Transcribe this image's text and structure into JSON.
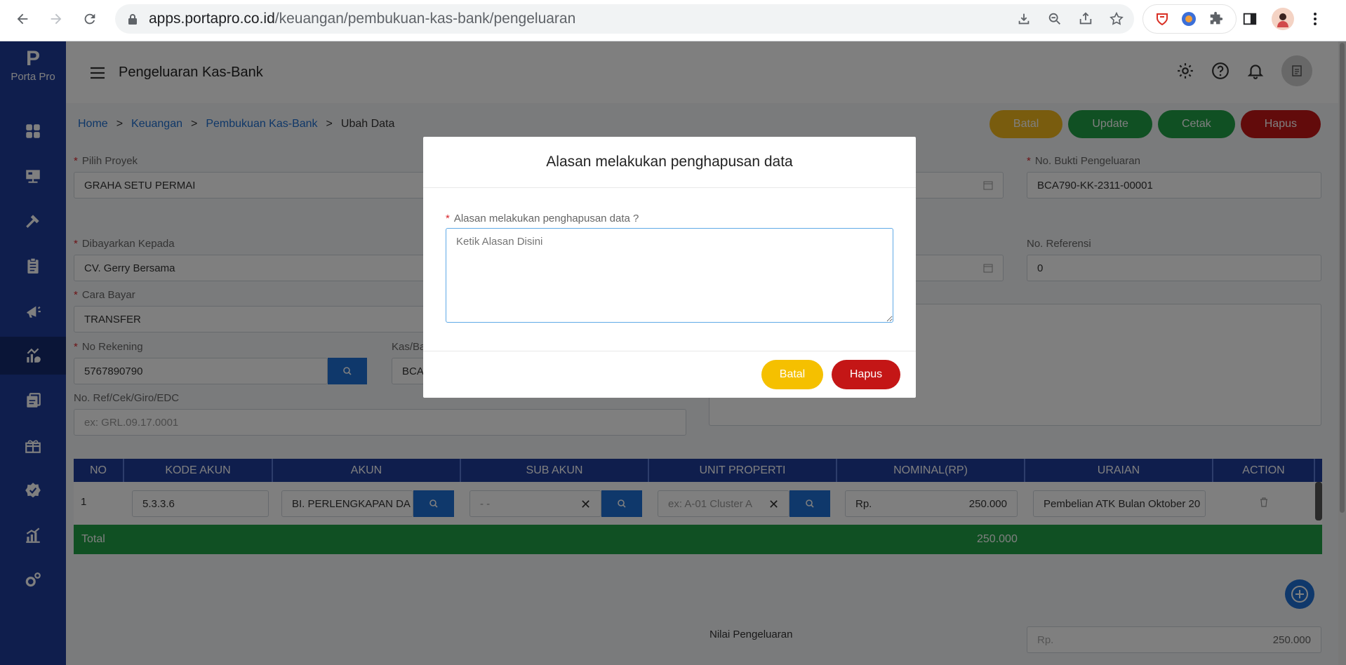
{
  "browser": {
    "url_domain": "apps.portapro.co.id",
    "url_path": "/keuangan/pembukuan-kas-bank/pengeluaran"
  },
  "app": {
    "logo_text": "Porta Pro",
    "logo_mark": "P",
    "page_title": "Pengeluaran Kas-Bank"
  },
  "breadcrumb": {
    "home": "Home",
    "keuangan": "Keuangan",
    "pembukuan": "Pembukuan Kas-Bank",
    "current": "Ubah Data",
    "sep": ">"
  },
  "actions": {
    "batal": "Batal",
    "update": "Update",
    "cetak": "Cetak",
    "hapus": "Hapus"
  },
  "form": {
    "proyek_label": "Pilih Proyek",
    "proyek_value": "GRAHA SETU PERMAI",
    "bukti_label": "No. Bukti Pengeluaran",
    "bukti_value": "BCA790-KK-2311-00001",
    "dibayarkan_label": "Dibayarkan Kepada",
    "dibayarkan_value": "CV. Gerry Bersama",
    "referensi_label": "No. Referensi",
    "referensi_value": "0",
    "cara_bayar_label": "Cara Bayar",
    "cara_bayar_value": "TRANSFER",
    "rekening_label": "No Rekening",
    "rekening_value": "5767890790",
    "kas_bank_label": "Kas/Ba",
    "kas_bank_value": "BCA",
    "ref_cek_label": "No. Ref/Cek/Giro/EDC",
    "ref_cek_placeholder": "ex: GRL.09.17.0001",
    "nilai_label": "Nilai Pengeluaran",
    "nilai_prefix": "Rp.",
    "nilai_value": "250.000"
  },
  "table": {
    "headers": [
      "NO",
      "KODE AKUN",
      "AKUN",
      "SUB AKUN",
      "UNIT PROPERTI",
      "NOMINAL(RP)",
      "URAIAN",
      "ACTION"
    ],
    "row": {
      "no": "1",
      "kode_akun": "5.3.3.6",
      "akun": "BI. PERLENGKAPAN DA",
      "sub_akun": "- -",
      "unit_placeholder": "ex: A-01 Cluster A",
      "nominal_prefix": "Rp.",
      "nominal": "250.000",
      "uraian": "Pembelian ATK Bulan Oktober 20"
    },
    "total_label": "Total",
    "total_value": "250.000"
  },
  "modal": {
    "title": "Alasan melakukan penghapusan data",
    "label": "Alasan melakukan penghapusan data ?",
    "placeholder": "Ketik Alasan Disini",
    "batal": "Batal",
    "hapus": "Hapus"
  },
  "icons": {
    "sidebar": [
      "dashboard-icon",
      "project-icon",
      "construction-icon",
      "clipboard-icon",
      "marketing-icon",
      "finance-icon",
      "billing-icon",
      "gift-icon",
      "badge-icon",
      "chart-icon",
      "settings-icon"
    ]
  },
  "colors": {
    "sidebar": "#1f3c9b",
    "yellow": "#f3b81c",
    "green": "#21a046",
    "red": "#c41616",
    "blue": "#1e70d6"
  }
}
